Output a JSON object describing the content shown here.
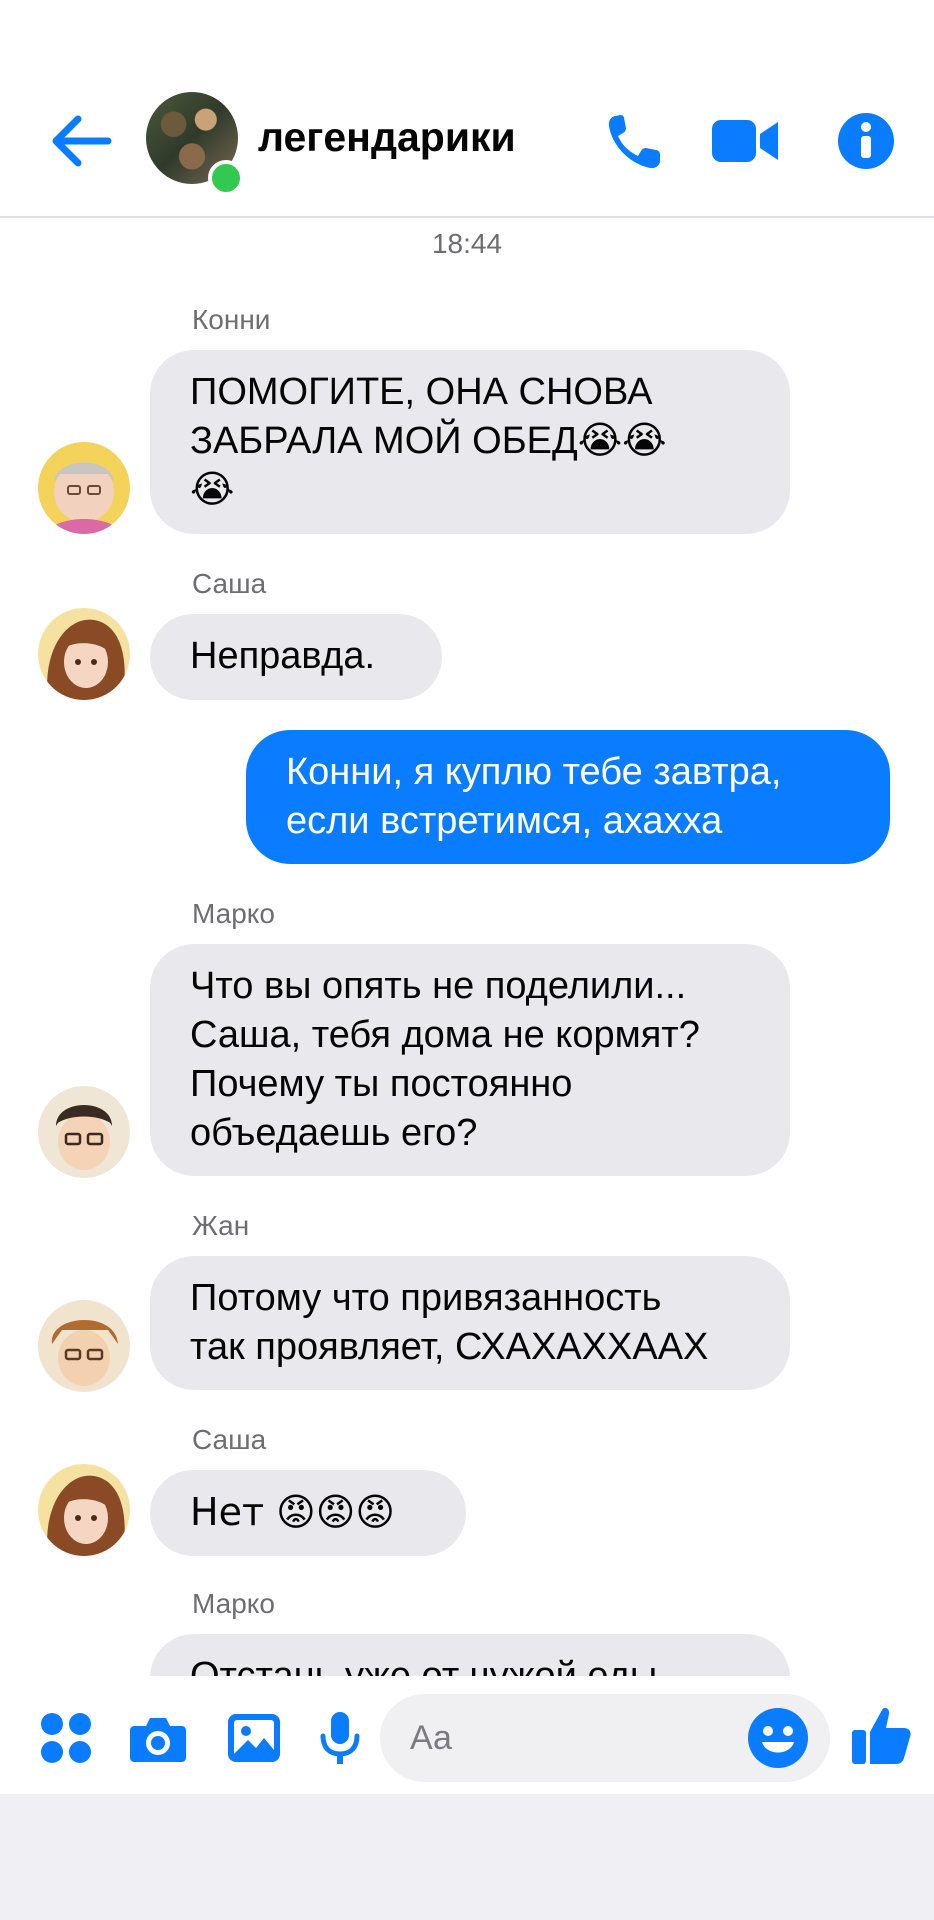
{
  "header": {
    "title": "легендарики",
    "back_icon": "arrow-left-icon",
    "call_icon": "phone-icon",
    "video_icon": "video-camera-icon",
    "info_icon": "info-icon",
    "accent": "#0a7cff",
    "online_color": "#31c950"
  },
  "conversation": {
    "timestamp": "18:44",
    "messages": [
      {
        "sender": "Конни",
        "text": "ПОМОГИТЕ, ОНА СНОВА\nЗАБРАЛА МОЙ ОБЕД😭😭\n😭",
        "direction": "in"
      },
      {
        "sender": "Саша",
        "text": "Неправда.",
        "direction": "in"
      },
      {
        "sender": "",
        "text": "Конни, я куплю тебе завтра,\nесли встретимся, ахахха",
        "direction": "out"
      },
      {
        "sender": "Марко",
        "text": "Что вы опять не поделили...\nСаша, тебя дома не кормят?\nПочему ты постоянно\nобъедаешь его?",
        "direction": "in"
      },
      {
        "sender": "Жан",
        "text": "Потому что привязанность\nтак проявляет, СХАХАХХААХ",
        "direction": "in"
      },
      {
        "sender": "Саша",
        "text": "Нет 😡😡😡",
        "direction": "in"
      },
      {
        "sender": "Марко",
        "text": "Отстань уже от чужой еды",
        "direction": "in"
      }
    ],
    "bubble_in_color": "#e9e8ec",
    "bubble_out_color": "#0a7cff"
  },
  "composer": {
    "placeholder": "Аа",
    "icons": [
      "apps-grid-icon",
      "camera-icon",
      "gallery-icon",
      "microphone-icon",
      "emoji-icon",
      "thumbs-up-icon"
    ]
  }
}
